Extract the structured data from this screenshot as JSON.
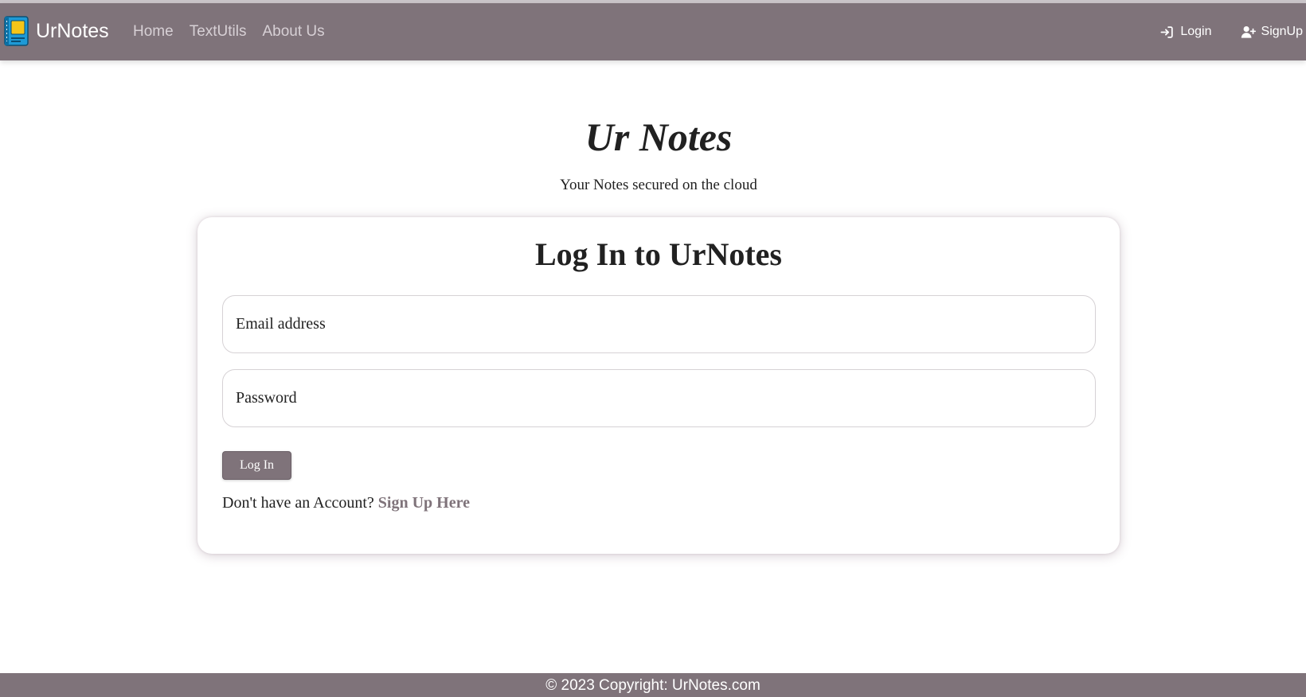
{
  "navbar": {
    "brand": "UrNotes",
    "brand_icon": "notebook-icon",
    "links": [
      "Home",
      "TextUtils",
      "About Us"
    ],
    "login_label": "Login",
    "login_icon": "login-arrow-icon",
    "signup_label": "SignUp",
    "signup_icon": "user-plus-icon",
    "background": "#7f737a"
  },
  "hero": {
    "title": "Ur Notes",
    "subtitle": "Your Notes secured on the cloud"
  },
  "login_card": {
    "title": "Log In to UrNotes",
    "email_placeholder": "Email address",
    "password_placeholder": "Password",
    "submit_label": "Log In",
    "signup_prompt": "Don't have an Account?",
    "signup_link": "Sign Up Here"
  },
  "footer": {
    "text": "© 2023 Copyright: UrNotes.com"
  },
  "colors": {
    "accent": "#7f737a",
    "text": "#212121"
  }
}
